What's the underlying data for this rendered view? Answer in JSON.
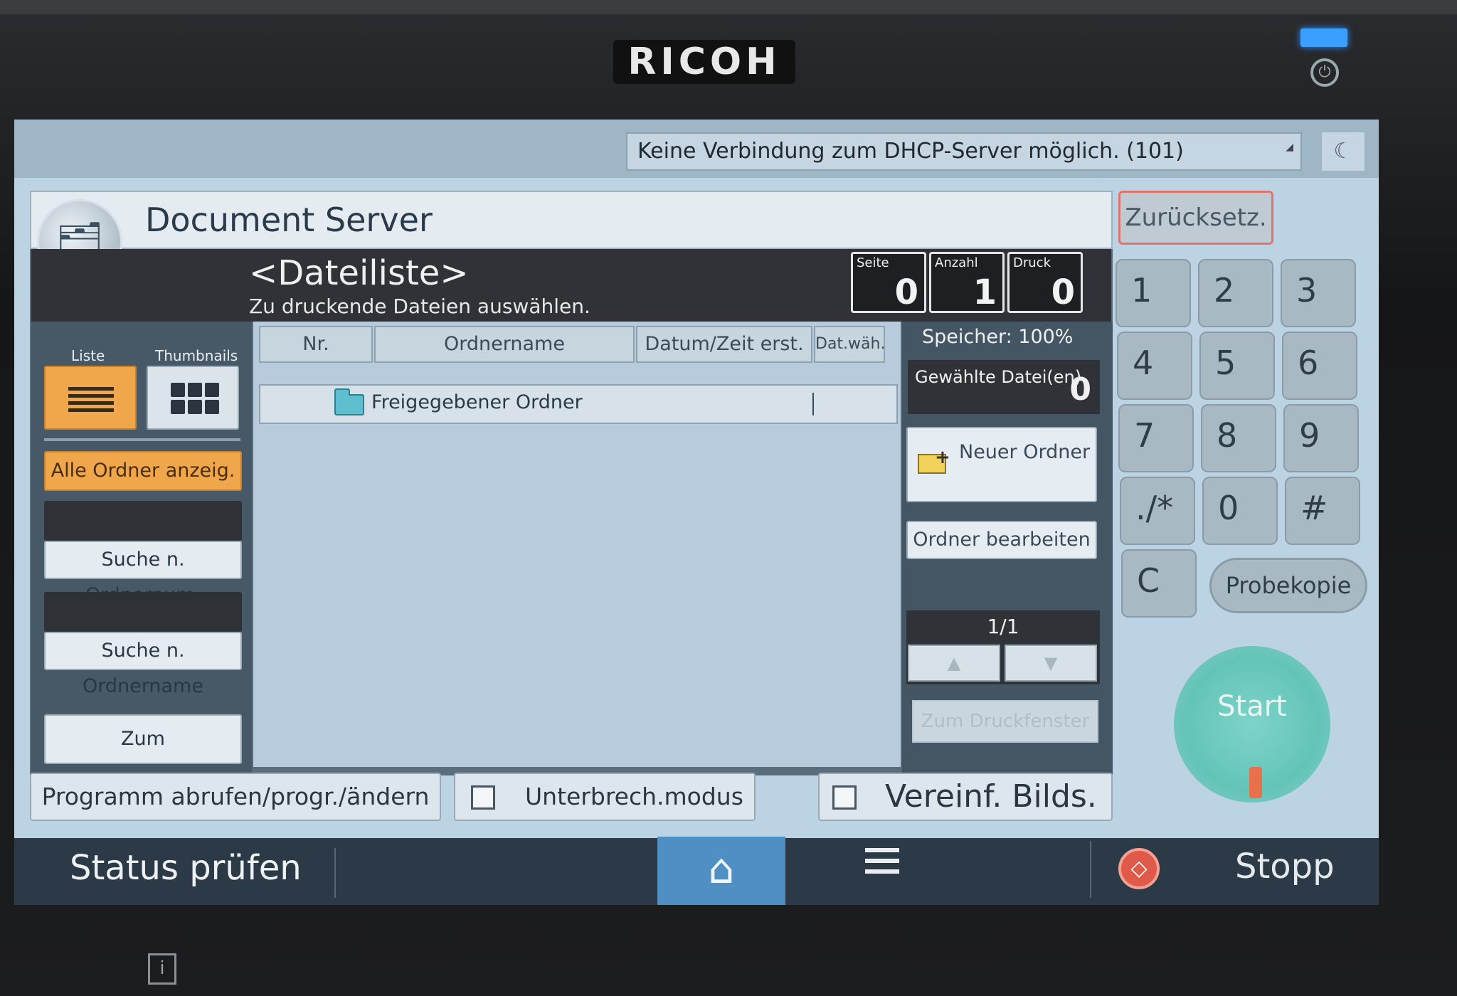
{
  "device": {
    "brand": "RICOH"
  },
  "notification": {
    "message": "Keine Verbindung zum DHCP-Server möglich. (101)"
  },
  "app": {
    "title": "Document Server",
    "header_title": "<Dateiliste>",
    "header_subtitle": "Zu druckende Dateien auswählen.",
    "counters": [
      {
        "label": "Seite",
        "value": "0"
      },
      {
        "label": "Anzahl",
        "value": "1"
      },
      {
        "label": "Druck",
        "value": "0"
      }
    ]
  },
  "view_toggle": {
    "list_label": "Liste",
    "thumbnails_label": "Thumbnails",
    "selected": "Liste"
  },
  "sidebar": {
    "show_all_folders": "Alle Ordner anzeig.",
    "search_by_number": "Suche n. Ordnernum.",
    "search_by_name": "Suche n. Ordnername",
    "to_scan_screen": "Zum Scanbildschirm"
  },
  "file_table": {
    "columns": [
      "Nr.",
      "Ordnername",
      "Datum/Zeit erst.",
      "Dat.wäh."
    ],
    "rows": [
      {
        "name": "Freigegebener Ordner"
      }
    ]
  },
  "right_panel": {
    "memory": "Speicher: 100%",
    "selected_files_label": "Gewählte Datei(en)",
    "selected_files_count": "0",
    "new_folder": "Neuer Ordner",
    "edit_folder": "Ordner bearbeiten",
    "page_indicator": "1/1",
    "to_print_window": "Zum Druckfenster"
  },
  "bottom_buttons": {
    "program": "Programm abrufen/progr./ändern",
    "interrupt": "Unterbrech.modus",
    "simplified": "Vereinf. Bilds."
  },
  "keypad": {
    "reset": "Zurücksetz.",
    "keys": [
      "1",
      "2",
      "3",
      "4",
      "5",
      "6",
      "7",
      "8",
      "9",
      "./*",
      "0",
      "#",
      "C"
    ],
    "proof_copy": "Probekopie",
    "start": "Start"
  },
  "status_bar": {
    "check_status": "Status prüfen",
    "stop": "Stopp"
  },
  "colors": {
    "accent_orange": "#f0a64a",
    "home_blue": "#4f8fc4",
    "start_teal": "#63c4b8",
    "stop_red": "#e05a4a"
  }
}
